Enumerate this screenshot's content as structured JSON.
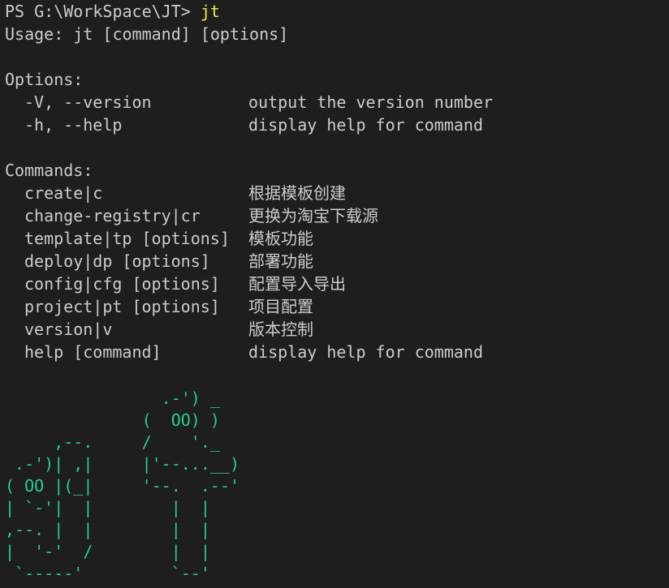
{
  "prompt": {
    "path": "PS G:\\WorkSpace\\JT> ",
    "command": "jt"
  },
  "usage": "Usage: jt [command] [options]",
  "options_header": "Options:",
  "options": [
    {
      "flag": "-V, --version",
      "desc": "output the version number"
    },
    {
      "flag": "-h, --help",
      "desc": "display help for command"
    }
  ],
  "commands_header": "Commands:",
  "commands": [
    {
      "name": "create|c",
      "desc": "根据模板创建"
    },
    {
      "name": "change-registry|cr",
      "desc": "更换为淘宝下载源"
    },
    {
      "name": "template|tp [options]",
      "desc": "模板功能"
    },
    {
      "name": "deploy|dp [options]",
      "desc": "部署功能"
    },
    {
      "name": "config|cfg [options]",
      "desc": "配置导入导出"
    },
    {
      "name": "project|pt [options]",
      "desc": "项目配置"
    },
    {
      "name": "version|v",
      "desc": "版本控制"
    },
    {
      "name": "help [command]",
      "desc": "display help for command"
    }
  ],
  "ascii_art": "                .-') _\n              (  OO) )\n     ,--.     /    '._\n .-')| ,|     |'--...__)\n( OO |(_|     '--.  .--'\n| `-'|  |        |  |\n,--. |  |        |  |\n|  '-'  /        |  |\n `-----'         `--'",
  "colors": {
    "background": "#1e1e1e",
    "text": "#cccccc",
    "command": "#f5e94a",
    "ascii": "#23d18b"
  }
}
